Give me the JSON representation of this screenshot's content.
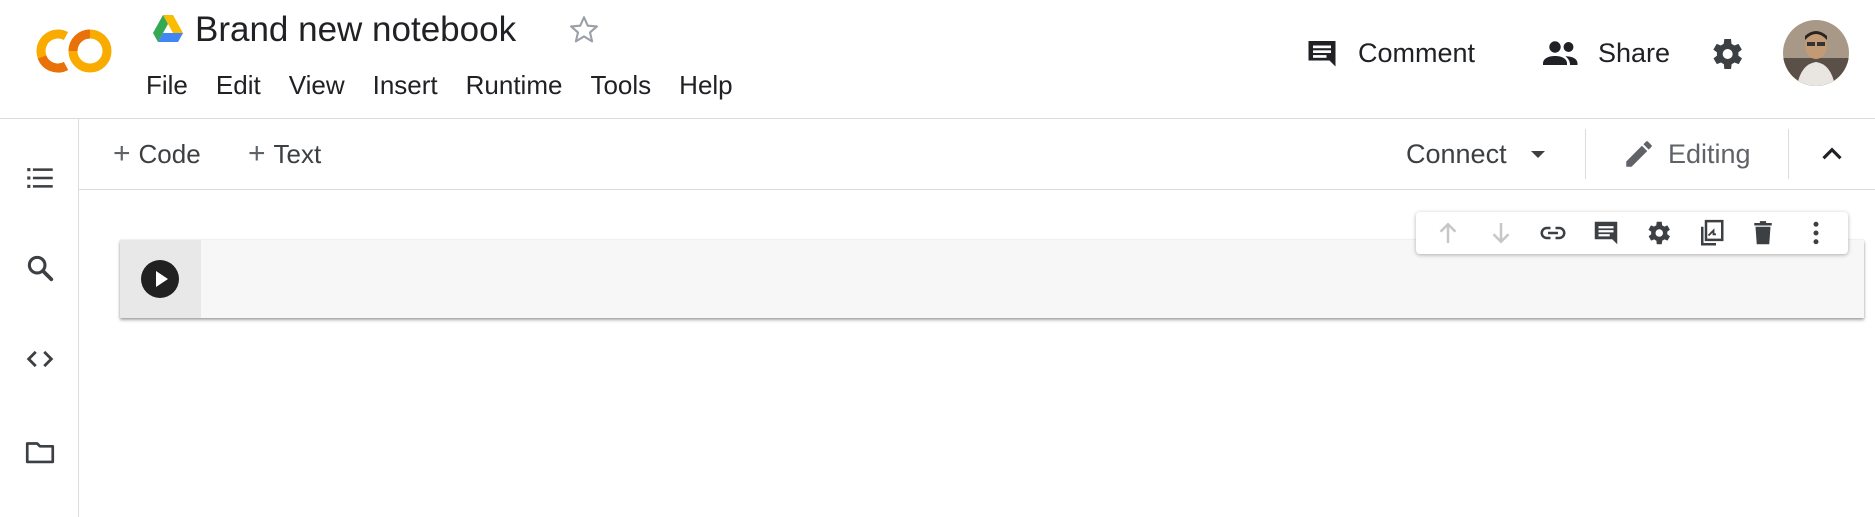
{
  "header": {
    "title": "Brand new notebook",
    "menu": [
      "File",
      "Edit",
      "View",
      "Insert",
      "Runtime",
      "Tools",
      "Help"
    ],
    "comment_label": "Comment",
    "share_label": "Share"
  },
  "toolbar": {
    "add_code_label": "Code",
    "add_text_label": "Text",
    "connect_label": "Connect",
    "editing_label": "Editing"
  },
  "icons": {
    "logo": "colab-logo",
    "drive": "google-drive-icon",
    "star": "star-outline-icon",
    "comment": "comment-icon",
    "share": "people-icon",
    "settings": "gear-icon",
    "sidebar": [
      "table-of-contents-icon",
      "search-icon",
      "code-snippets-icon",
      "files-folder-icon"
    ],
    "cell_toolbar": [
      "arrow-up-icon",
      "arrow-down-icon",
      "link-icon",
      "comment-icon",
      "gear-icon",
      "mirror-cell-icon",
      "delete-icon",
      "more-vert-icon"
    ]
  },
  "colors": {
    "logo_orange": "#f9ab00",
    "logo_dark_orange": "#e8710a",
    "icon_dark": "#3c4043",
    "border": "#dadce0",
    "cell_bg": "#f7f7f7"
  }
}
